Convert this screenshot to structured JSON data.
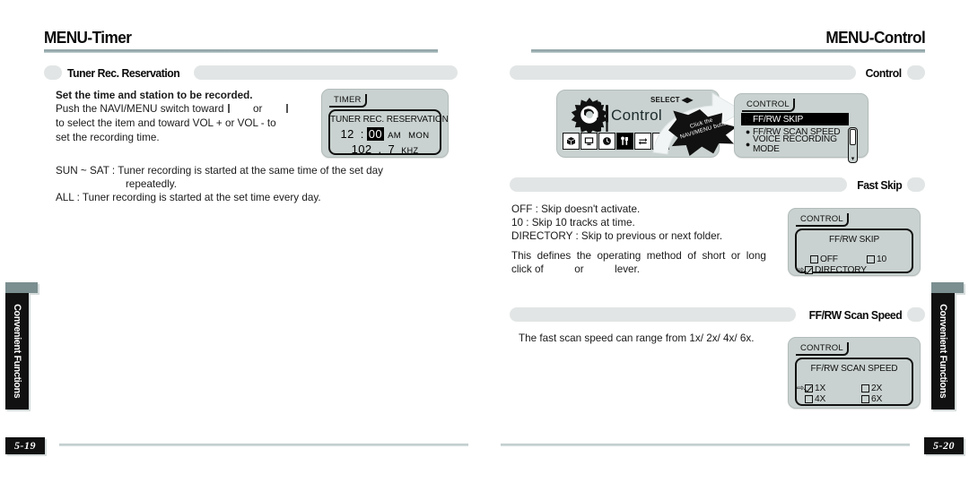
{
  "left_page": {
    "chapter_title": "MENU-Timer",
    "page_number": "5-19",
    "side_tab": "Convenient Functions",
    "section": {
      "title": "Tuner Rec. Reservation",
      "heading": "Set the time and station to be recorded.",
      "para1_a": "Push the NAVI/MENU switch toward ",
      "para1_b": " or ",
      "para1_c": "",
      "para2": "to select the item and toward VOL + or VOL - to\nset the recording time.",
      "para3_label": "SUN ~ SAT : ",
      "para3_text": "Tuner recording is started at the same time of the set day",
      "para3_cont": "repeatedly.",
      "para4": "ALL : Tuner recording is started at the set time every day."
    },
    "lcd": {
      "tab_label": "TIMER",
      "title": "TUNER REC. RESERVATION",
      "hour": "12",
      "colon": ":",
      "minute_highlighted": "00",
      "meridiem": "AM",
      "day": "MON",
      "freq_whole": "102",
      "freq_dot": ".",
      "freq_frac": "7",
      "freq_unit": "KHZ"
    }
  },
  "right_page": {
    "chapter_title": "MENU-Control",
    "page_number": "5-20",
    "side_tab": "Convenient Functions",
    "sections": [
      {
        "title": "Control"
      },
      {
        "title": "Fast Skip"
      },
      {
        "title": "FF/RW Scan Speed"
      }
    ],
    "control_graphic": {
      "word": "Control",
      "select_label": "SELECT",
      "select_arrows": "◀▶",
      "burst_line1": "Click the",
      "burst_line2": "NAVI/MENU button",
      "strip_icons": [
        {
          "name": "box-icon",
          "glyph": "❐"
        },
        {
          "name": "monitor-icon",
          "glyph": "▣"
        },
        {
          "name": "clock-icon",
          "glyph": "◴"
        },
        {
          "name": "tools-icon",
          "glyph": "⚒"
        },
        {
          "name": "repeat-icon",
          "glyph": "⇄"
        },
        {
          "name": "music-note-icon",
          "glyph": "♫"
        }
      ]
    },
    "control_lcd": {
      "tab_label": "CONTROL",
      "items": [
        {
          "marker": "▷",
          "label": "FF/RW SKIP",
          "selected": true
        },
        {
          "marker": "●",
          "label": "FF/RW SCAN SPEED",
          "selected": false
        },
        {
          "marker": "●",
          "label": "VOICE RECORDING MODE",
          "selected": false
        }
      ]
    },
    "fast_skip": {
      "line1": "OFF : Skip doesn't activate.",
      "line2": "10 : Skip 10 tracks at time.",
      "line3": "DIRECTORY : Skip to previous or next folder.",
      "line4": "This  defines  the  operating  method  of  short  or  long",
      "line5_a": "click of ",
      "line5_b": " or ",
      "line5_c": " lever.",
      "lcd": {
        "tab_label": "CONTROL",
        "title": "FF/RW SKIP",
        "options": [
          {
            "label": "OFF",
            "checked": false,
            "cursor": false
          },
          {
            "label": "10",
            "checked": false,
            "cursor": false
          },
          {
            "label": "DIRECTORY",
            "checked": true,
            "cursor": true
          }
        ]
      }
    },
    "scan_speed": {
      "line1": "The fast scan speed can range from 1x/ 2x/ 4x/ 6x.",
      "lcd": {
        "tab_label": "CONTROL",
        "title": "FF/RW SCAN SPEED",
        "options": [
          {
            "label": "1X",
            "checked": true,
            "cursor": true
          },
          {
            "label": "2X",
            "checked": false,
            "cursor": false
          },
          {
            "label": "4X",
            "checked": false,
            "cursor": false
          },
          {
            "label": "6X",
            "checked": false,
            "cursor": false
          }
        ]
      }
    }
  },
  "colors": {
    "rule": "#8fa3a6",
    "section_bar": "#e2e5e5",
    "lcd_bg": "#c9d2d0",
    "ink": "#111111"
  }
}
